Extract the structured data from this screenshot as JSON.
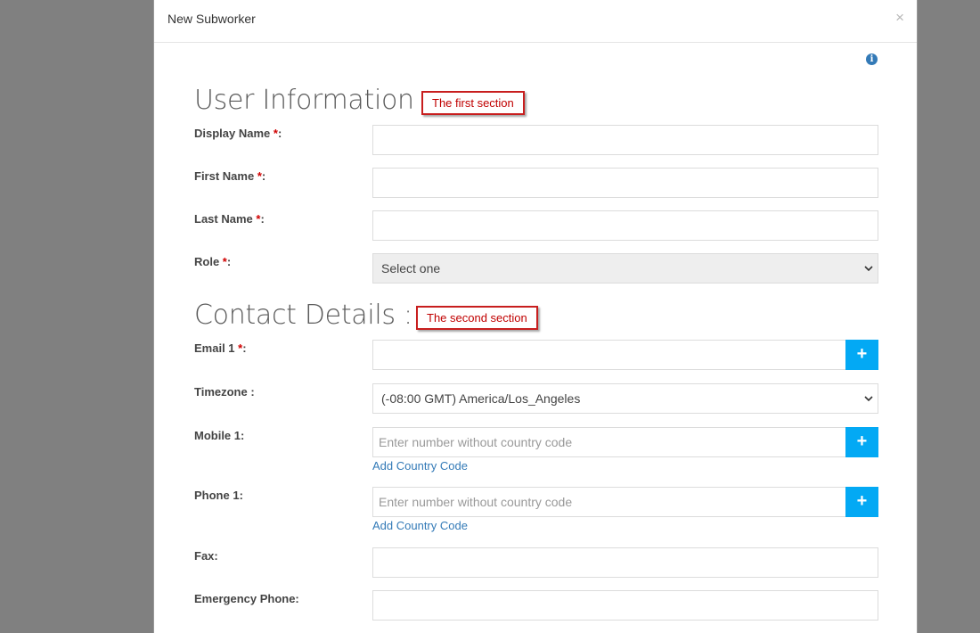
{
  "modal": {
    "title": "New Subworker",
    "close": "×"
  },
  "info_icon": "i",
  "sections": {
    "user_info": {
      "title": "User Information :",
      "callout": "The first section"
    },
    "contact": {
      "title": "Contact Details :",
      "callout": "The second section"
    }
  },
  "required_mark": "*",
  "fields": {
    "display_name": {
      "label": "Display Name",
      "suffix": ":",
      "value": ""
    },
    "first_name": {
      "label": "First Name",
      "suffix": ":",
      "value": ""
    },
    "last_name": {
      "label": "Last Name",
      "suffix": ":",
      "value": ""
    },
    "role": {
      "label": "Role",
      "suffix": ":",
      "selected": "Select one"
    },
    "email1": {
      "label": "Email 1",
      "suffix": ":",
      "value": "",
      "add": "+"
    },
    "timezone": {
      "label": "Timezone :",
      "selected": "(-08:00 GMT) America/Los_Angeles"
    },
    "mobile1": {
      "label": "Mobile 1:",
      "placeholder": "Enter number without country code",
      "add": "+",
      "link": "Add Country Code"
    },
    "phone1": {
      "label": "Phone 1:",
      "placeholder": "Enter number without country code",
      "add": "+",
      "link": "Add Country Code"
    },
    "fax": {
      "label": "Fax:",
      "value": ""
    },
    "emergency_phone": {
      "label": "Emergency Phone:",
      "value": ""
    }
  },
  "colors": {
    "accent": "#03a9f4",
    "link": "#337ab7",
    "required": "#d00000",
    "callout_border": "#c81e1e",
    "overlay": "#808080"
  }
}
